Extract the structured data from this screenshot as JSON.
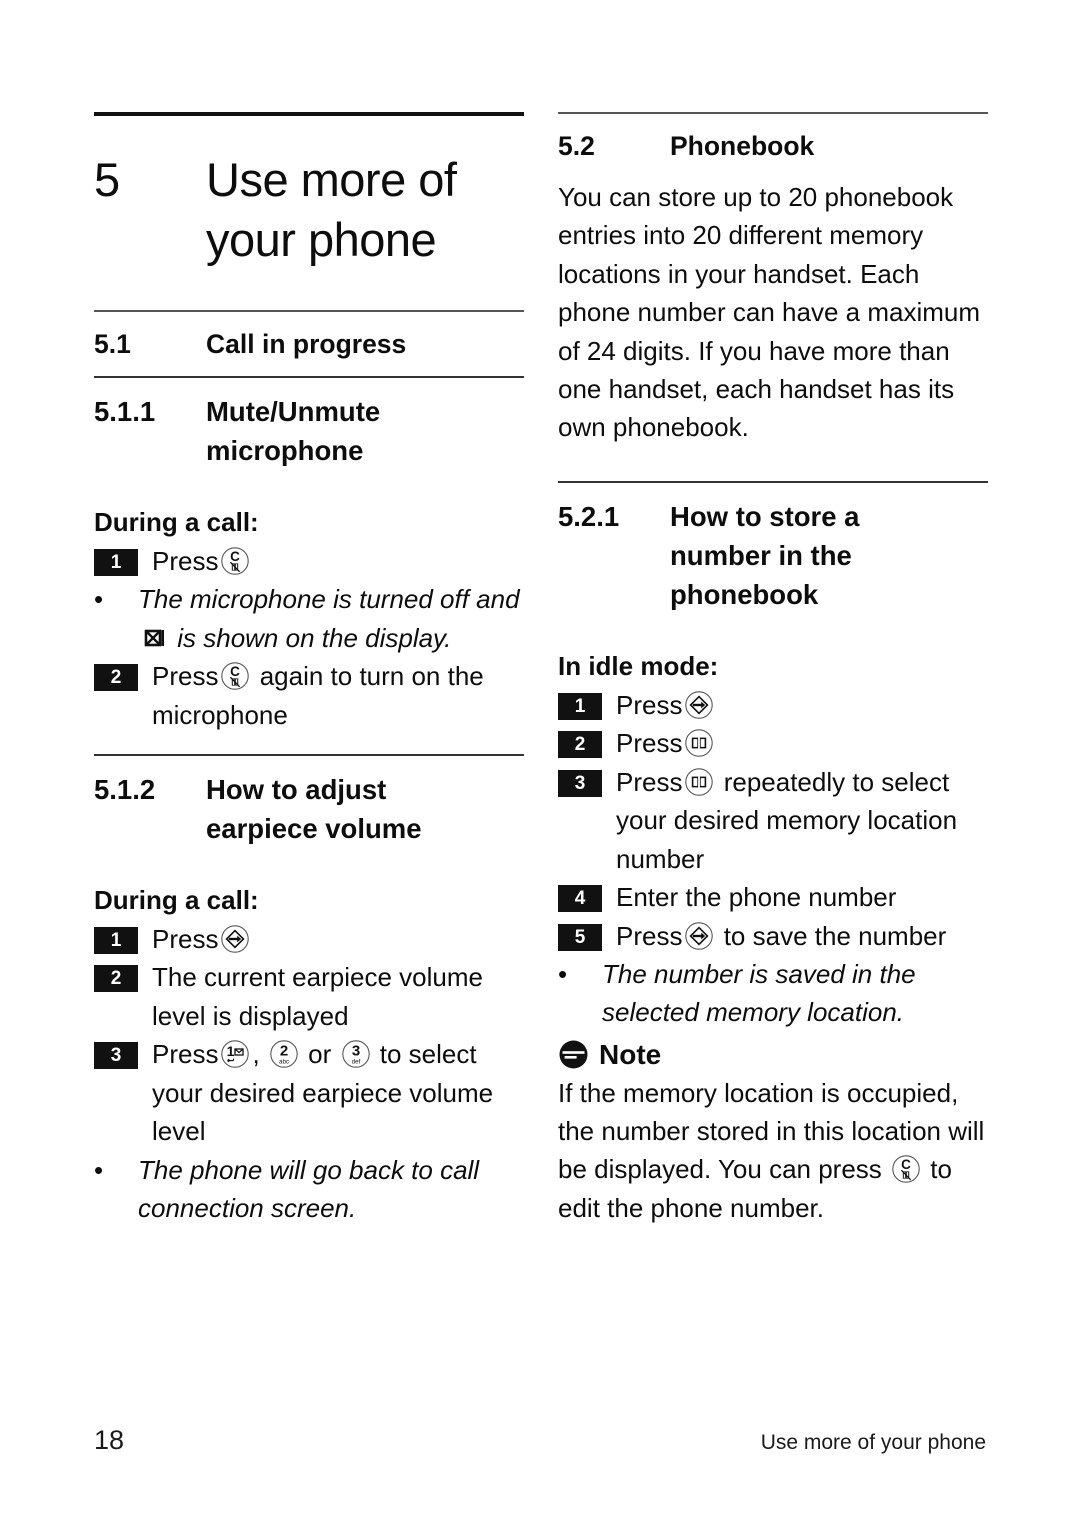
{
  "page": {
    "number": "18",
    "footer_title": "Use more of your phone"
  },
  "chapter": {
    "number": "5",
    "title_line1": "Use more of",
    "title_line2": "your phone"
  },
  "left_column": {
    "section_5_1": {
      "number": "5.1",
      "title": "Call in progress"
    },
    "section_5_1_1": {
      "number": "5.1.1",
      "title_line1": "Mute/Unmute",
      "title_line2": "microphone",
      "subhead": "During a call:",
      "steps": [
        {
          "badge": "1",
          "text_before": "Press",
          "icon": "mute-key-icon",
          "text_after": ""
        },
        {
          "badge": "2",
          "text_before": "Press",
          "icon": "mute-key-icon",
          "text_after": "again to turn on the microphone"
        }
      ],
      "bullet": {
        "dot": "•",
        "text_before": "The microphone is turned off and",
        "icon": "mute-display-icon",
        "text_after": "is shown on the display."
      }
    },
    "section_5_1_2": {
      "number": "5.1.2",
      "title_line1": "How to adjust",
      "title_line2": "earpiece volume",
      "subhead": "During a call:",
      "steps": [
        {
          "badge": "1",
          "text_before": "Press",
          "icon": "menu-ok-key-icon",
          "text_after": ""
        },
        {
          "badge": "2",
          "text_before": "The current earpiece volume level is displayed",
          "icon": "",
          "text_after": ""
        },
        {
          "badge": "3",
          "text_before": "Press",
          "icon": "key-1-icon",
          "mid1": ",",
          "icon2": "key-2-icon",
          "mid2": "or",
          "icon3": "key-3-icon",
          "text_after": "to select your desired earpiece volume level"
        }
      ],
      "bullet": {
        "dot": "•",
        "text": "The phone will go back to call connection screen."
      }
    }
  },
  "right_column": {
    "section_5_2": {
      "number": "5.2",
      "title": "Phonebook",
      "body": "You can store up to 20 phonebook entries into 20 different memory locations in your handset. Each phone number can have a maximum of 24 digits. If you have more than one handset, each handset has its own phonebook."
    },
    "section_5_2_1": {
      "number": "5.2.1",
      "title_line1": "How to store a",
      "title_line2": "number in the",
      "title_line3": "phonebook",
      "subhead": "In idle mode:",
      "steps": [
        {
          "badge": "1",
          "text_before": "Press",
          "icon": "menu-ok-key-icon",
          "text_after": ""
        },
        {
          "badge": "2",
          "text_before": "Press",
          "icon": "phonebook-key-icon",
          "text_after": ""
        },
        {
          "badge": "3",
          "text_before": "Press",
          "icon": "phonebook-key-icon",
          "text_after": "repeatedly to select your desired memory location number"
        },
        {
          "badge": "4",
          "text_before": "Enter the phone number",
          "icon": "",
          "text_after": ""
        },
        {
          "badge": "5",
          "text_before": "Press",
          "icon": "menu-ok-key-icon",
          "text_after": "to save the number"
        }
      ],
      "bullet": {
        "dot": "•",
        "text": "The number is saved in the selected memory location."
      },
      "note": {
        "icon": "note-icon",
        "label": "Note",
        "text_before": "If the memory location is occupied, the number stored in this location will be displayed. You can press",
        "icon_inline": "mute-key-icon",
        "text_after": "to edit the phone number."
      }
    }
  },
  "colors": {
    "text": "#0d0d0d",
    "rule_dark": "#111111",
    "rule_light": "#555555",
    "badge_bg": "#111111",
    "badge_fg": "#ffffff"
  }
}
